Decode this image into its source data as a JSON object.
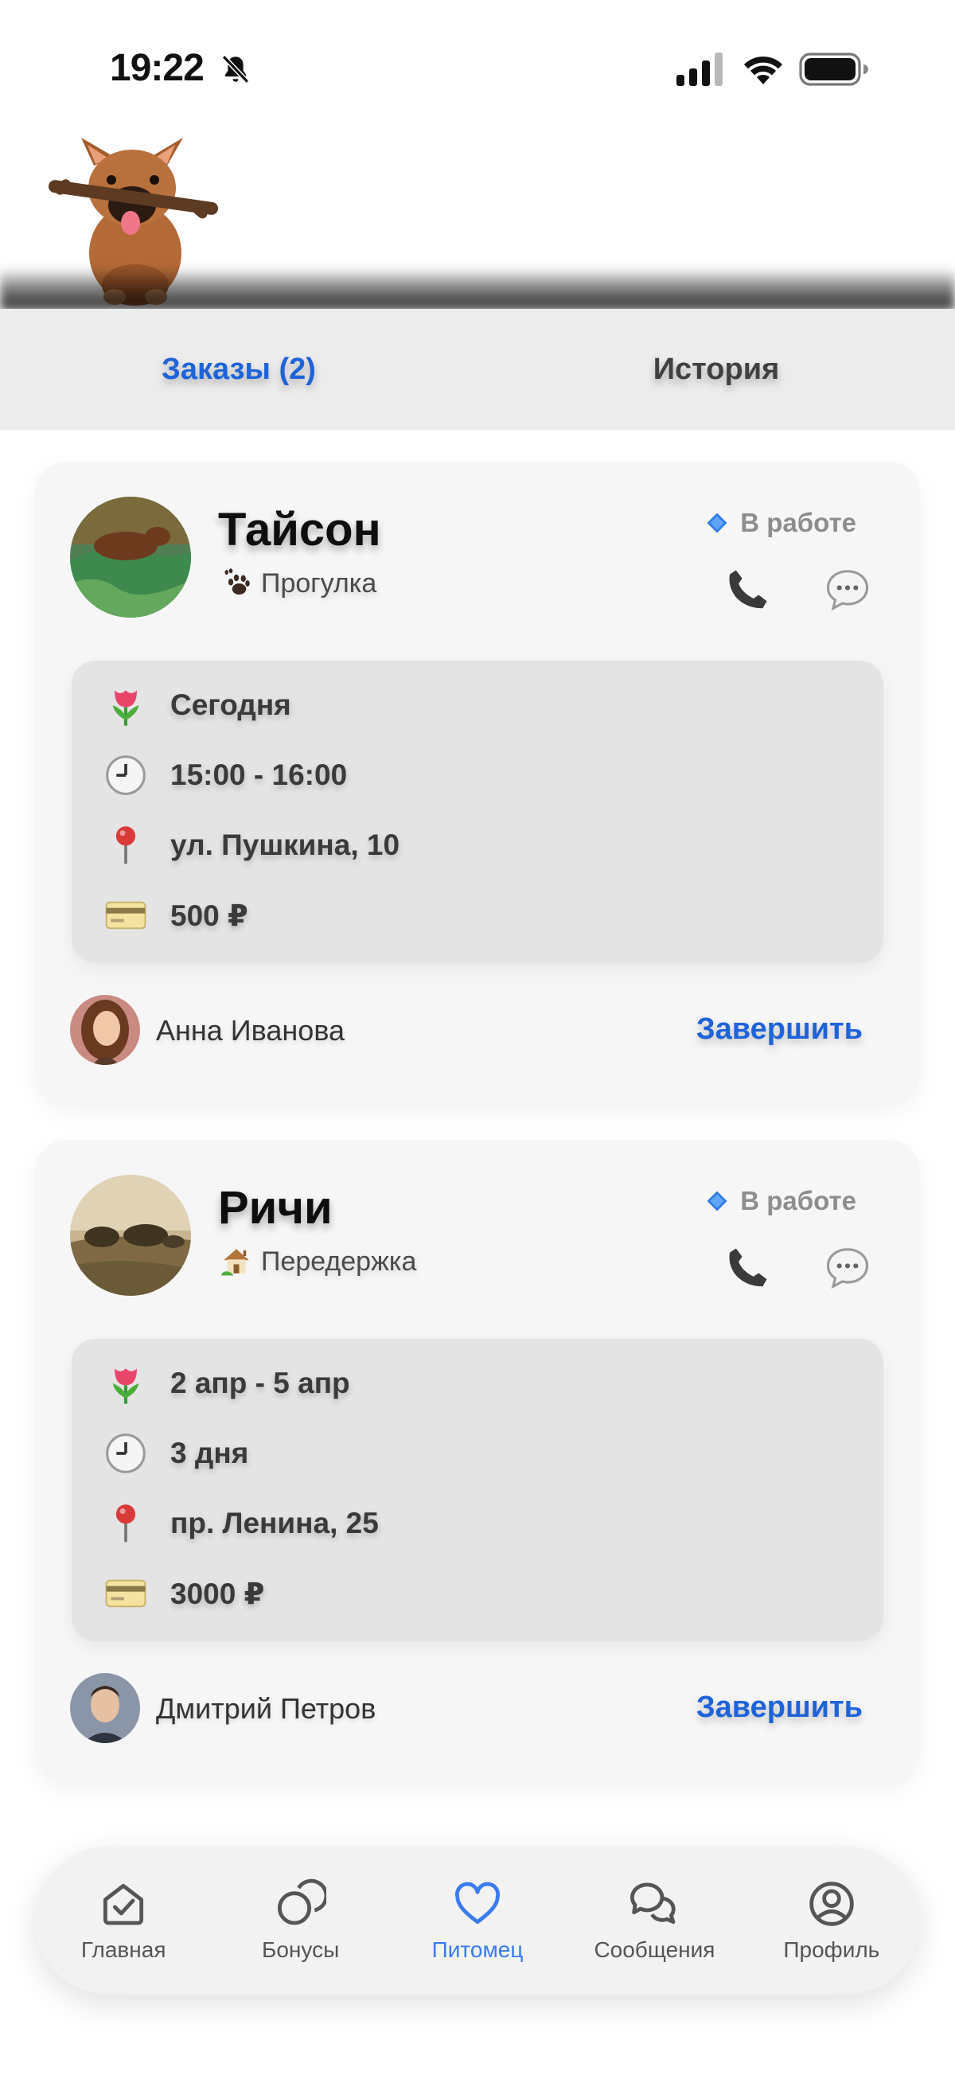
{
  "status_bar": {
    "time": "19:22"
  },
  "tabs": [
    {
      "label": "Заказы (2)",
      "active": true
    },
    {
      "label": "История",
      "active": false
    }
  ],
  "orders": [
    {
      "pet_name": "Тайсон",
      "service_icon": "paw-icon",
      "service": "Прогулка",
      "status_icon": "blue-diamond-icon",
      "status": "В работе",
      "details": [
        {
          "icon": "tulip-icon",
          "text": "Сегодня"
        },
        {
          "icon": "clock-icon",
          "text": "15:00 - 16:00"
        },
        {
          "icon": "pin-icon",
          "text": "ул. Пушкина, 10"
        },
        {
          "icon": "card-icon",
          "text": "500 ₽"
        }
      ],
      "owner_name": "Анна Иванова",
      "action": "Завершить"
    },
    {
      "pet_name": "Ричи",
      "service_icon": "house-icon",
      "service": "Передержка",
      "status_icon": "blue-diamond-icon",
      "status": "В работе",
      "details": [
        {
          "icon": "tulip-icon",
          "text": "2 апр - 5 апр"
        },
        {
          "icon": "clock-icon",
          "text": "3 дня"
        },
        {
          "icon": "pin-icon",
          "text": "пр. Ленина, 25"
        },
        {
          "icon": "card-icon",
          "text": "3000 ₽"
        }
      ],
      "owner_name": "Дмитрий Петров",
      "action": "Завершить"
    }
  ],
  "nav": [
    {
      "icon": "home-check-icon",
      "label": "Главная",
      "active": false
    },
    {
      "icon": "coins-icon",
      "label": "Бонусы",
      "active": false
    },
    {
      "icon": "heart-icon",
      "label": "Питомец",
      "active": true
    },
    {
      "icon": "chat-bubbles-icon",
      "label": "Сообщения",
      "active": false
    },
    {
      "icon": "profile-icon",
      "label": "Профиль",
      "active": false
    }
  ],
  "colors": {
    "accent": "#1e63d9",
    "nav_active": "#3a7bf0",
    "status": "#8d8d8d"
  }
}
